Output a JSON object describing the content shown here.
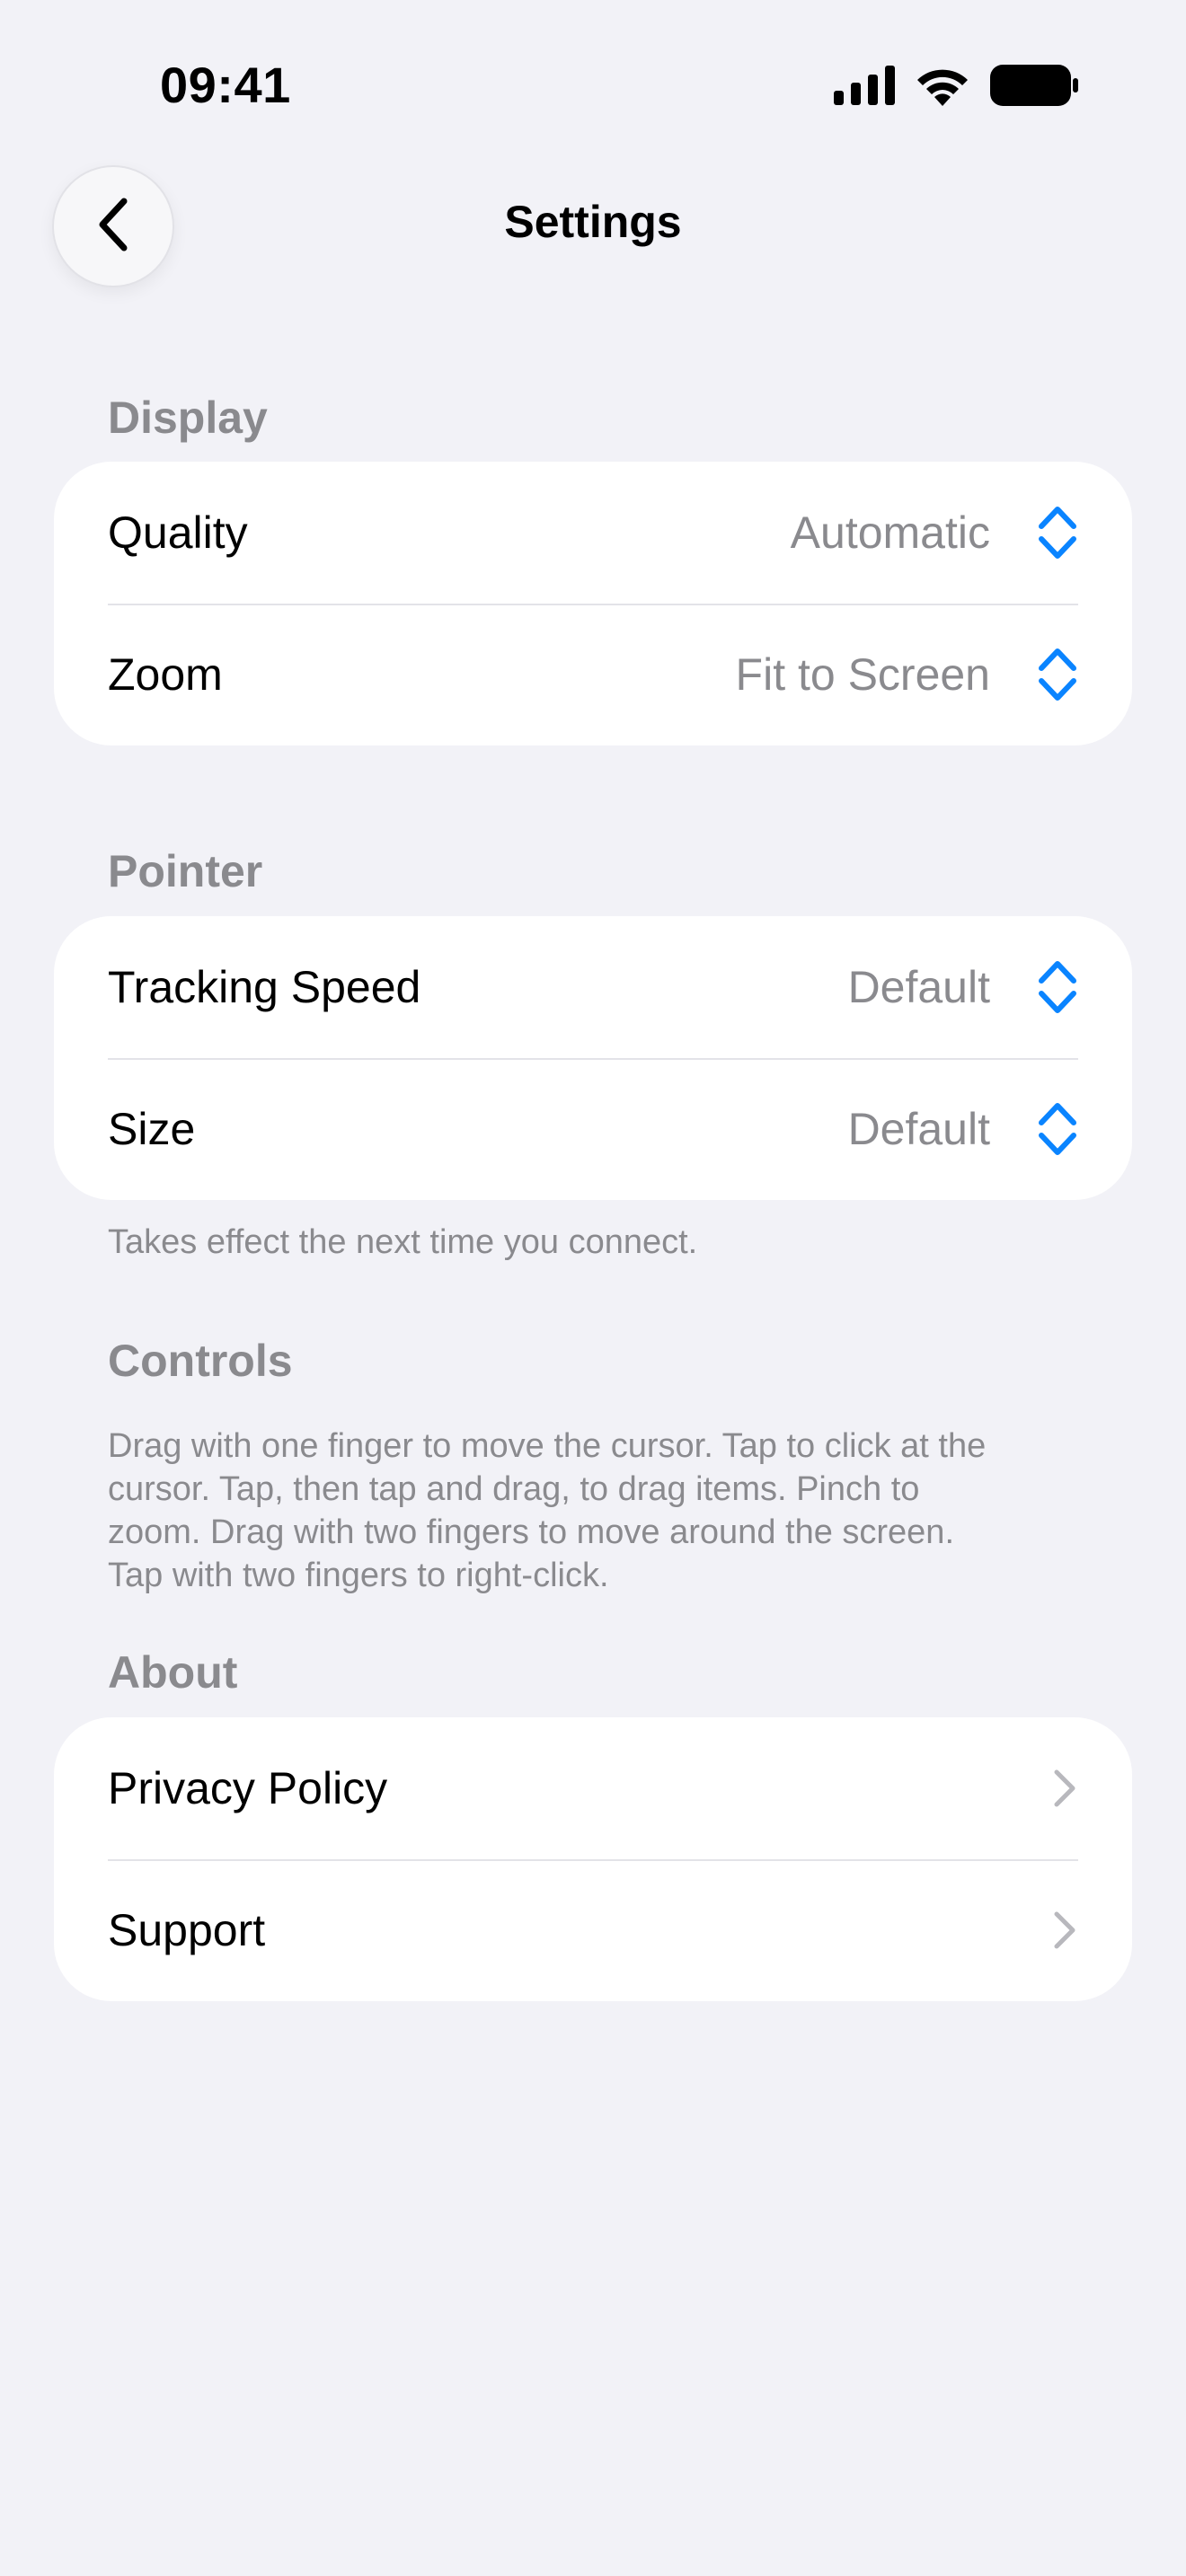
{
  "status_bar": {
    "time": "09:41",
    "icons": [
      "cellular-signal-icon",
      "wifi-icon",
      "battery-icon"
    ]
  },
  "nav": {
    "back_icon": "chevron-left-icon",
    "title": "Settings"
  },
  "display": {
    "header": "Display",
    "rows": [
      {
        "label": "Quality",
        "value": "Automatic",
        "icon": "up-down-chevron-icon"
      },
      {
        "label": "Zoom",
        "value": "Fit to Screen",
        "icon": "up-down-chevron-icon"
      }
    ]
  },
  "pointer": {
    "header": "Pointer",
    "rows": [
      {
        "label": "Tracking Speed",
        "value": "Default",
        "icon": "up-down-chevron-icon"
      },
      {
        "label": "Size",
        "value": "Default",
        "icon": "up-down-chevron-icon"
      }
    ],
    "footnote": "Takes effect the next time you connect."
  },
  "controls": {
    "header": "Controls",
    "lines": [
      "Drag with one finger to move the cursor. Tap to click at the",
      "cursor. Tap, then tap and drag, to drag items. Pinch to",
      "zoom. Drag with two fingers to move around the screen.",
      "Tap with two fingers to right-click."
    ]
  },
  "about": {
    "header": "About",
    "rows": [
      {
        "label": "Privacy Policy",
        "icon": "chevron-right-icon"
      },
      {
        "label": "Support",
        "icon": "chevron-right-icon"
      }
    ]
  },
  "colors": {
    "background": "#f2f2f7",
    "card": "#ffffff",
    "secondary_text": "#8a8a8e",
    "accent": "#0a84ff",
    "separator": "#e3e3e8",
    "chevron_gray": "#b8b8bd"
  }
}
